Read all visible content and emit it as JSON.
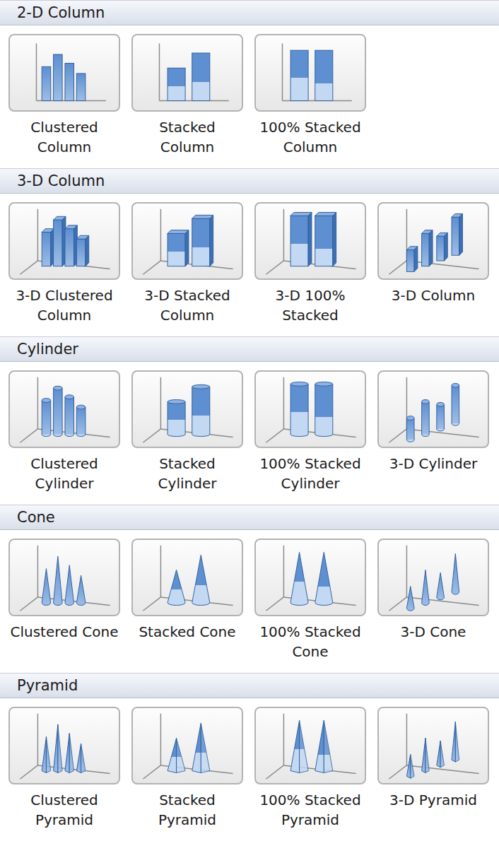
{
  "sections": [
    {
      "title": "2-D Column",
      "kind": "flat",
      "charts": [
        {
          "label": "Clustered Column",
          "kind": "clustered"
        },
        {
          "label": "Stacked Column",
          "kind": "stacked"
        },
        {
          "label": "100% Stacked Column",
          "kind": "percent"
        }
      ]
    },
    {
      "title": "3-D Column",
      "kind": "box",
      "charts": [
        {
          "label": "3-D Clustered Column",
          "kind": "clustered"
        },
        {
          "label": "3-D Stacked Column",
          "kind": "stacked"
        },
        {
          "label": "3-D 100% Stacked",
          "kind": "percent"
        },
        {
          "label": "3-D Column",
          "kind": "depth"
        }
      ]
    },
    {
      "title": "Cylinder",
      "kind": "cylinder",
      "charts": [
        {
          "label": "Clustered Cylinder",
          "kind": "clustered"
        },
        {
          "label": "Stacked Cylinder",
          "kind": "stacked"
        },
        {
          "label": "100% Stacked Cylinder",
          "kind": "percent"
        },
        {
          "label": "3-D Cylinder",
          "kind": "depth"
        }
      ]
    },
    {
      "title": "Cone",
      "kind": "cone",
      "charts": [
        {
          "label": "Clustered Cone",
          "kind": "clustered"
        },
        {
          "label": "Stacked Cone",
          "kind": "stacked"
        },
        {
          "label": "100% Stacked Cone",
          "kind": "percent"
        },
        {
          "label": "3-D Cone",
          "kind": "depth"
        }
      ]
    },
    {
      "title": "Pyramid",
      "kind": "pyramid",
      "charts": [
        {
          "label": "Clustered Pyramid",
          "kind": "clustered"
        },
        {
          "label": "Stacked Pyramid",
          "kind": "stacked"
        },
        {
          "label": "100% Stacked Pyramid",
          "kind": "percent"
        },
        {
          "label": "3-D Pyramid",
          "kind": "depth"
        }
      ]
    }
  ]
}
